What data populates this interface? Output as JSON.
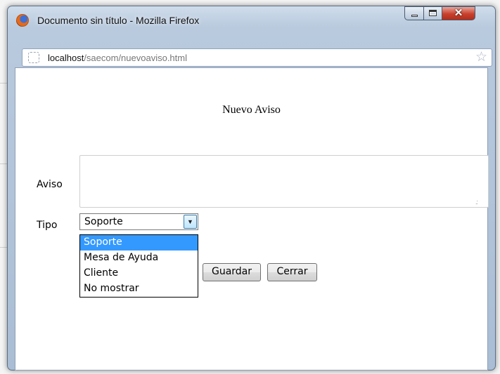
{
  "window": {
    "title": "Documento sin título - Mozilla Firefox",
    "minimize_icon": "minimize-icon",
    "maximize_icon": "maximize-icon",
    "close_glyph": "✕"
  },
  "urlbar": {
    "host": "localhost",
    "path": "/saecom/nuevoaviso.html",
    "bookmark_icon": "☆"
  },
  "page": {
    "heading": "Nuevo Aviso",
    "aviso_label": "Aviso",
    "aviso_value": "",
    "tipo_label": "Tipo",
    "tipo_selected": "Soporte",
    "tipo_options": [
      "Soporte",
      "Mesa de Ayuda",
      "Cliente",
      "No mostrar"
    ],
    "highlighted_option_index": 0,
    "guardar_label": "Guardar",
    "cerrar_label": "Cerrar",
    "dropdown_arrow": "▼"
  },
  "colors": {
    "selection": "#3399ff",
    "window_frame": "#b9cade"
  }
}
